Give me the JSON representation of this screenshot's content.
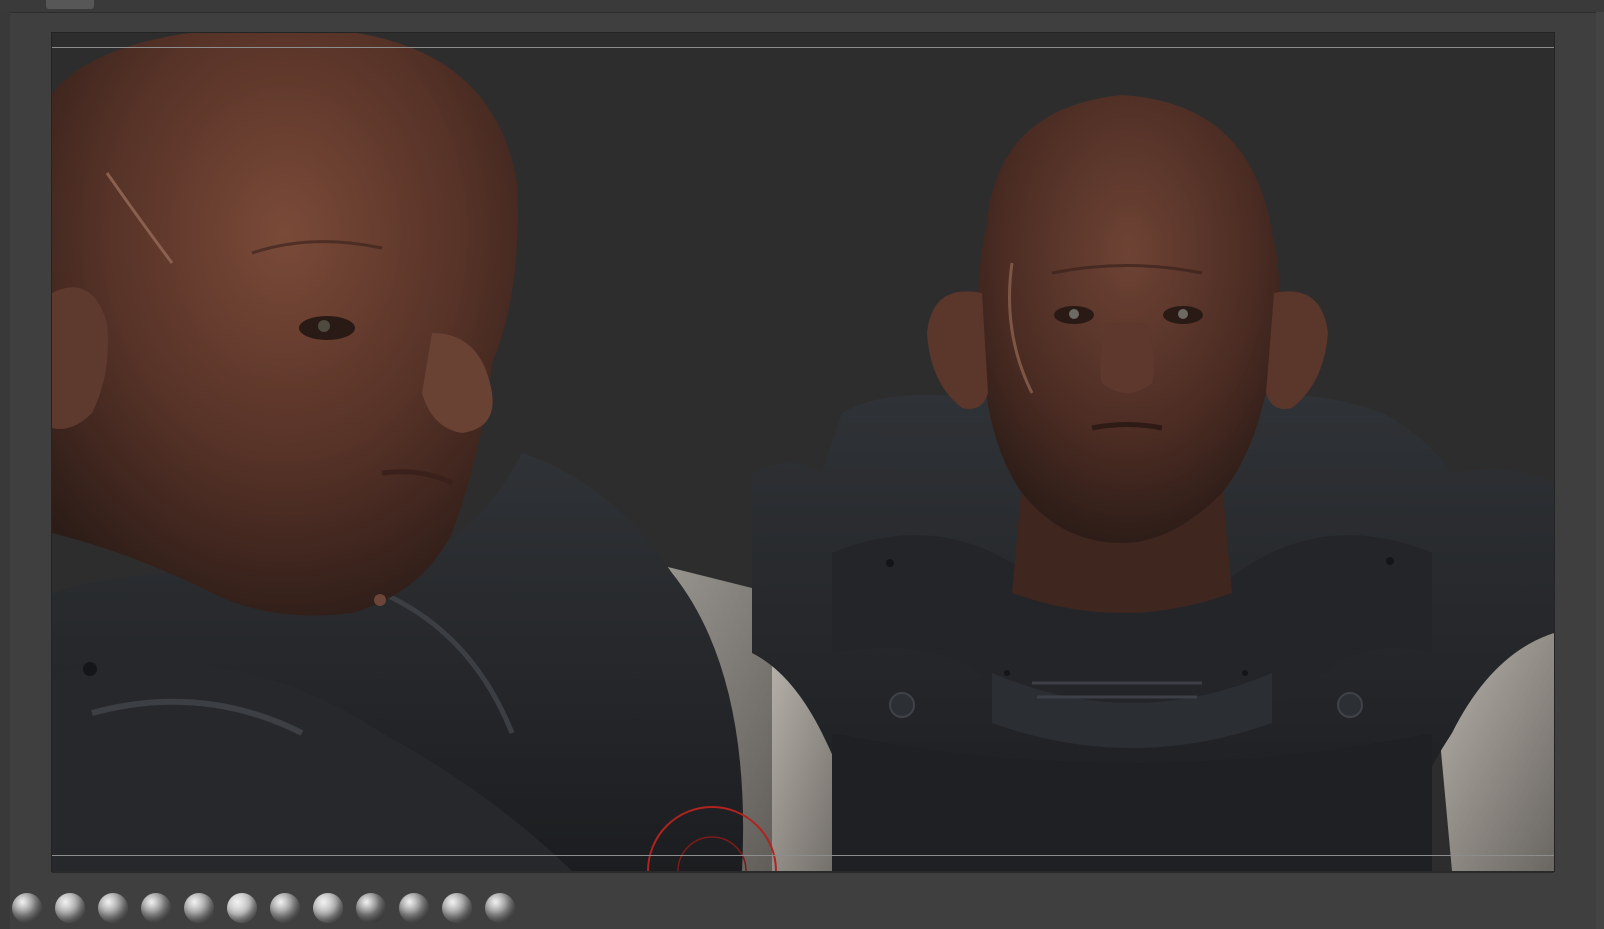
{
  "app": {
    "name": "sculpting-viewport",
    "accent_color": "#b0231e",
    "background_color": "#3f3f3f",
    "canvas_color": "#2d2d2d"
  },
  "materials": [
    {
      "icon": "matcap-sphere-icon",
      "color": "#8c8c8c"
    },
    {
      "icon": "matcap-sphere-icon",
      "color": "#a6a6a6"
    },
    {
      "icon": "matcap-sphere-icon",
      "color": "#9a9a9a"
    },
    {
      "icon": "matcap-cone-icon",
      "color": "#8a8a8a"
    },
    {
      "icon": "matcap-sphere-icon",
      "color": "#a0a0a0"
    },
    {
      "icon": "matcap-sphere-icon",
      "color": "#c2c2c2"
    },
    {
      "icon": "matcap-sphere-icon",
      "color": "#949494"
    },
    {
      "icon": "matcap-sphere-icon",
      "color": "#b4b4b4"
    },
    {
      "icon": "matcap-flat-icon",
      "color": "#7e7e7e"
    },
    {
      "icon": "matcap-cube-icon",
      "color": "#8a8a8a"
    },
    {
      "icon": "matcap-sphere-icon",
      "color": "#9c9c9c"
    },
    {
      "icon": "matcap-shell-icon",
      "color": "#8e8e8e"
    }
  ]
}
